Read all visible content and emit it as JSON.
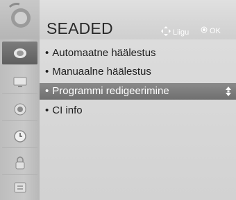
{
  "header": {
    "title": "SEADED",
    "move_hint": "Liigu",
    "ok_hint": "OK"
  },
  "sidebar": {
    "items": [
      {
        "icon": "settings-icon"
      },
      {
        "icon": "channel-dish-icon",
        "active": true
      },
      {
        "icon": "picture-tv-icon"
      },
      {
        "icon": "audio-speaker-icon"
      },
      {
        "icon": "clock-icon"
      },
      {
        "icon": "lock-icon"
      },
      {
        "icon": "options-icon"
      }
    ]
  },
  "menu": {
    "items": [
      {
        "label": "Automaatne häälestus"
      },
      {
        "label": "Manuaalne häälestus"
      },
      {
        "label": "Programmi redigeerimine",
        "selected": true
      },
      {
        "label": "CI info"
      }
    ]
  },
  "colors": {
    "selected_bg": "#7a7a7a",
    "panel_bg": "#d6d6d6"
  }
}
